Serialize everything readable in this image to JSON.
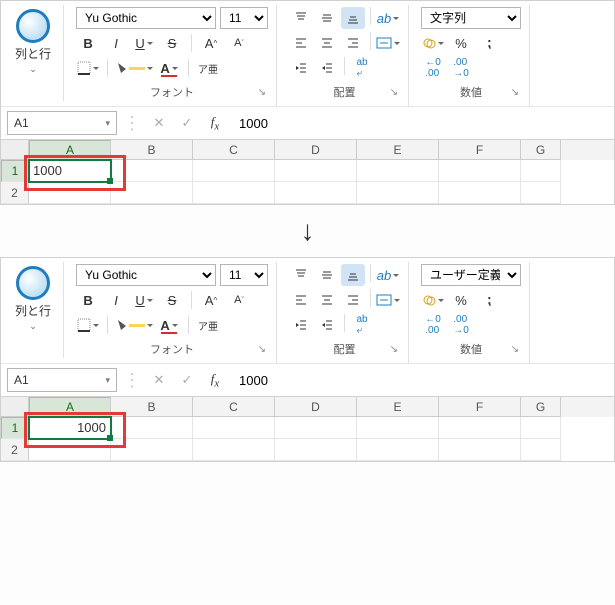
{
  "top": {
    "rowcol_label": "列と行",
    "font_name": "Yu Gothic",
    "font_size": "11",
    "font_group": "フォント",
    "align_group": "配置",
    "num_group": "数値",
    "num_format": "文字列",
    "ruby": "ア亜",
    "cell_ref": "A1",
    "formula": "1000",
    "cols": [
      "A",
      "B",
      "C",
      "D",
      "E",
      "F",
      "G"
    ],
    "rows": [
      "1",
      "2"
    ],
    "a1_value": "1000",
    "a1_align": "left"
  },
  "bottom": {
    "rowcol_label": "列と行",
    "font_name": "Yu Gothic",
    "font_size": "11",
    "font_group": "フォント",
    "align_group": "配置",
    "num_group": "数値",
    "num_format": "ユーザー定義",
    "ruby": "ア亜",
    "cell_ref": "A1",
    "formula": "1000",
    "cols": [
      "A",
      "B",
      "C",
      "D",
      "E",
      "F",
      "G"
    ],
    "rows": [
      "1",
      "2"
    ],
    "a1_value": "1000",
    "a1_align": "right"
  },
  "icons": {
    "bold": "B",
    "italic": "I",
    "underline": "U",
    "strike": "S"
  }
}
